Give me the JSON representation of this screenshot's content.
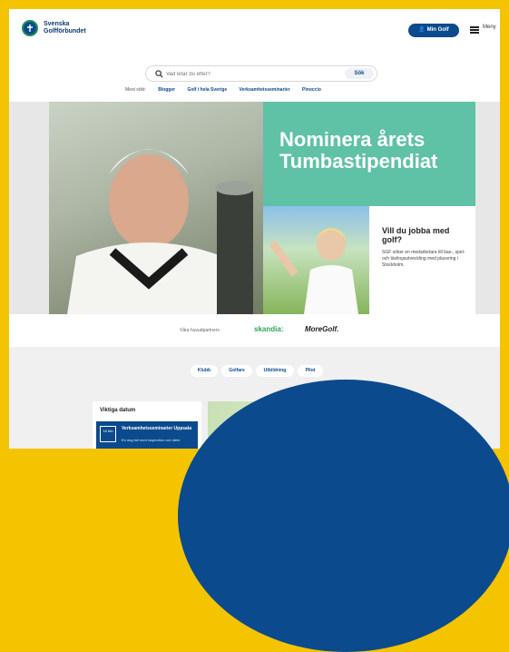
{
  "colors": {
    "frame": "#f5c400",
    "brand_blue": "#0b4a8c",
    "teal": "#5fc1a6",
    "green": "#2fa45a"
  },
  "header": {
    "logo_text": "Svenska Golfförbundet",
    "my_golf_label": "Min Golf",
    "menu_label": "Meny",
    "menu_icon": "hamburger-icon",
    "user_icon": "user-icon"
  },
  "search": {
    "placeholder": "Vad letar du efter?",
    "button_label": "Sök"
  },
  "quick_links": {
    "label": "Mest sökt:",
    "items": [
      "Blogger",
      "Golf i hela Sverige",
      "Verksamhetsseminarier",
      "Pinoccio"
    ]
  },
  "hero": {
    "headline": "Nominera årets Tumbastipendiat",
    "promo_title": "Vill du jobba med golf?",
    "promo_text": "SGF söker en medarbetare till bas-, spel- och tävlingsutveckling med placering i Stockholm."
  },
  "partners": {
    "label": "Våra huvudpartners",
    "items": [
      "skandia:",
      "MoreGolf."
    ]
  },
  "tabs": [
    "Klubb",
    "Golfare",
    "Utbildning",
    "Pilot"
  ],
  "dates": {
    "title": "Viktiga datum",
    "event_date": "16 feb",
    "event_title": "Verksamhetsseminarier Uppsala",
    "event_sub": "En dag full med inspiration och idéer"
  }
}
